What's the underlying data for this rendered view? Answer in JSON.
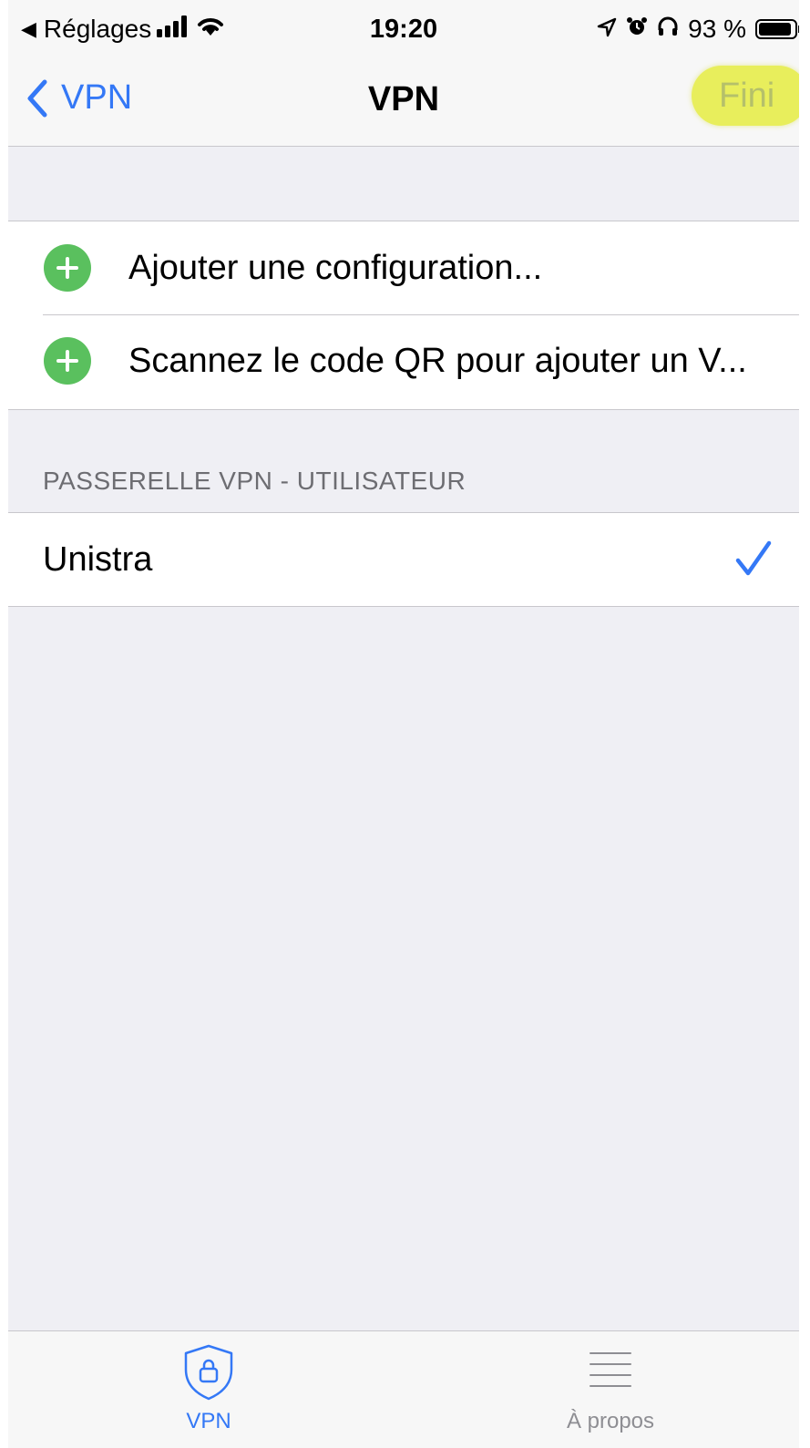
{
  "status_bar": {
    "back_app": "Réglages",
    "time": "19:20",
    "battery": "93 %"
  },
  "nav": {
    "back_label": "VPN",
    "title": "VPN",
    "done_label": "Fini"
  },
  "actions": [
    {
      "label": "Ajouter une configuration..."
    },
    {
      "label": "Scannez le code QR pour ajouter un V..."
    }
  ],
  "gateway_section": {
    "header": "PASSERELLE VPN - UTILISATEUR",
    "items": [
      {
        "label": "Unistra",
        "selected": true
      }
    ]
  },
  "tabs": [
    {
      "label": "VPN",
      "icon": "shield-lock-icon",
      "active": true
    },
    {
      "label": "À propos",
      "icon": "list-icon",
      "active": false
    }
  ],
  "colors": {
    "accent": "#3478f6",
    "add": "#5ac05e",
    "highlight": "#e8ee5c"
  }
}
